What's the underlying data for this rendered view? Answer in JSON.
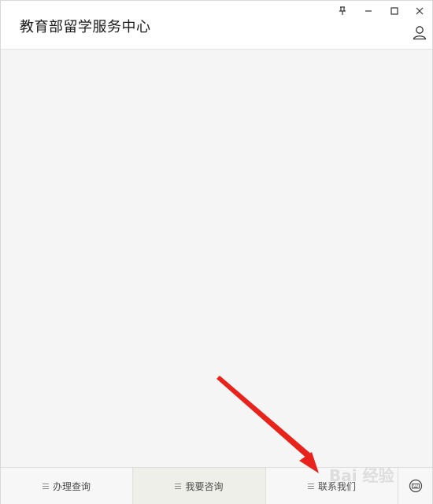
{
  "app": {
    "title": "教育部留学服务中心"
  },
  "window_controls": {
    "icons": [
      "pin-icon",
      "minimize-icon",
      "maximize-icon",
      "close-icon"
    ]
  },
  "header": {
    "user_icon": "user-icon"
  },
  "bottom_menu": {
    "tabs": [
      {
        "label": "办理查询",
        "icon": "menu-icon"
      },
      {
        "label": "我要咨询",
        "icon": "menu-icon"
      },
      {
        "label": "联系我们",
        "icon": "menu-icon"
      }
    ],
    "keyboard_icon": "keyboard-icon"
  },
  "overlay": {
    "arrow_color": "#e8231c",
    "watermark": "Bai 经验"
  }
}
